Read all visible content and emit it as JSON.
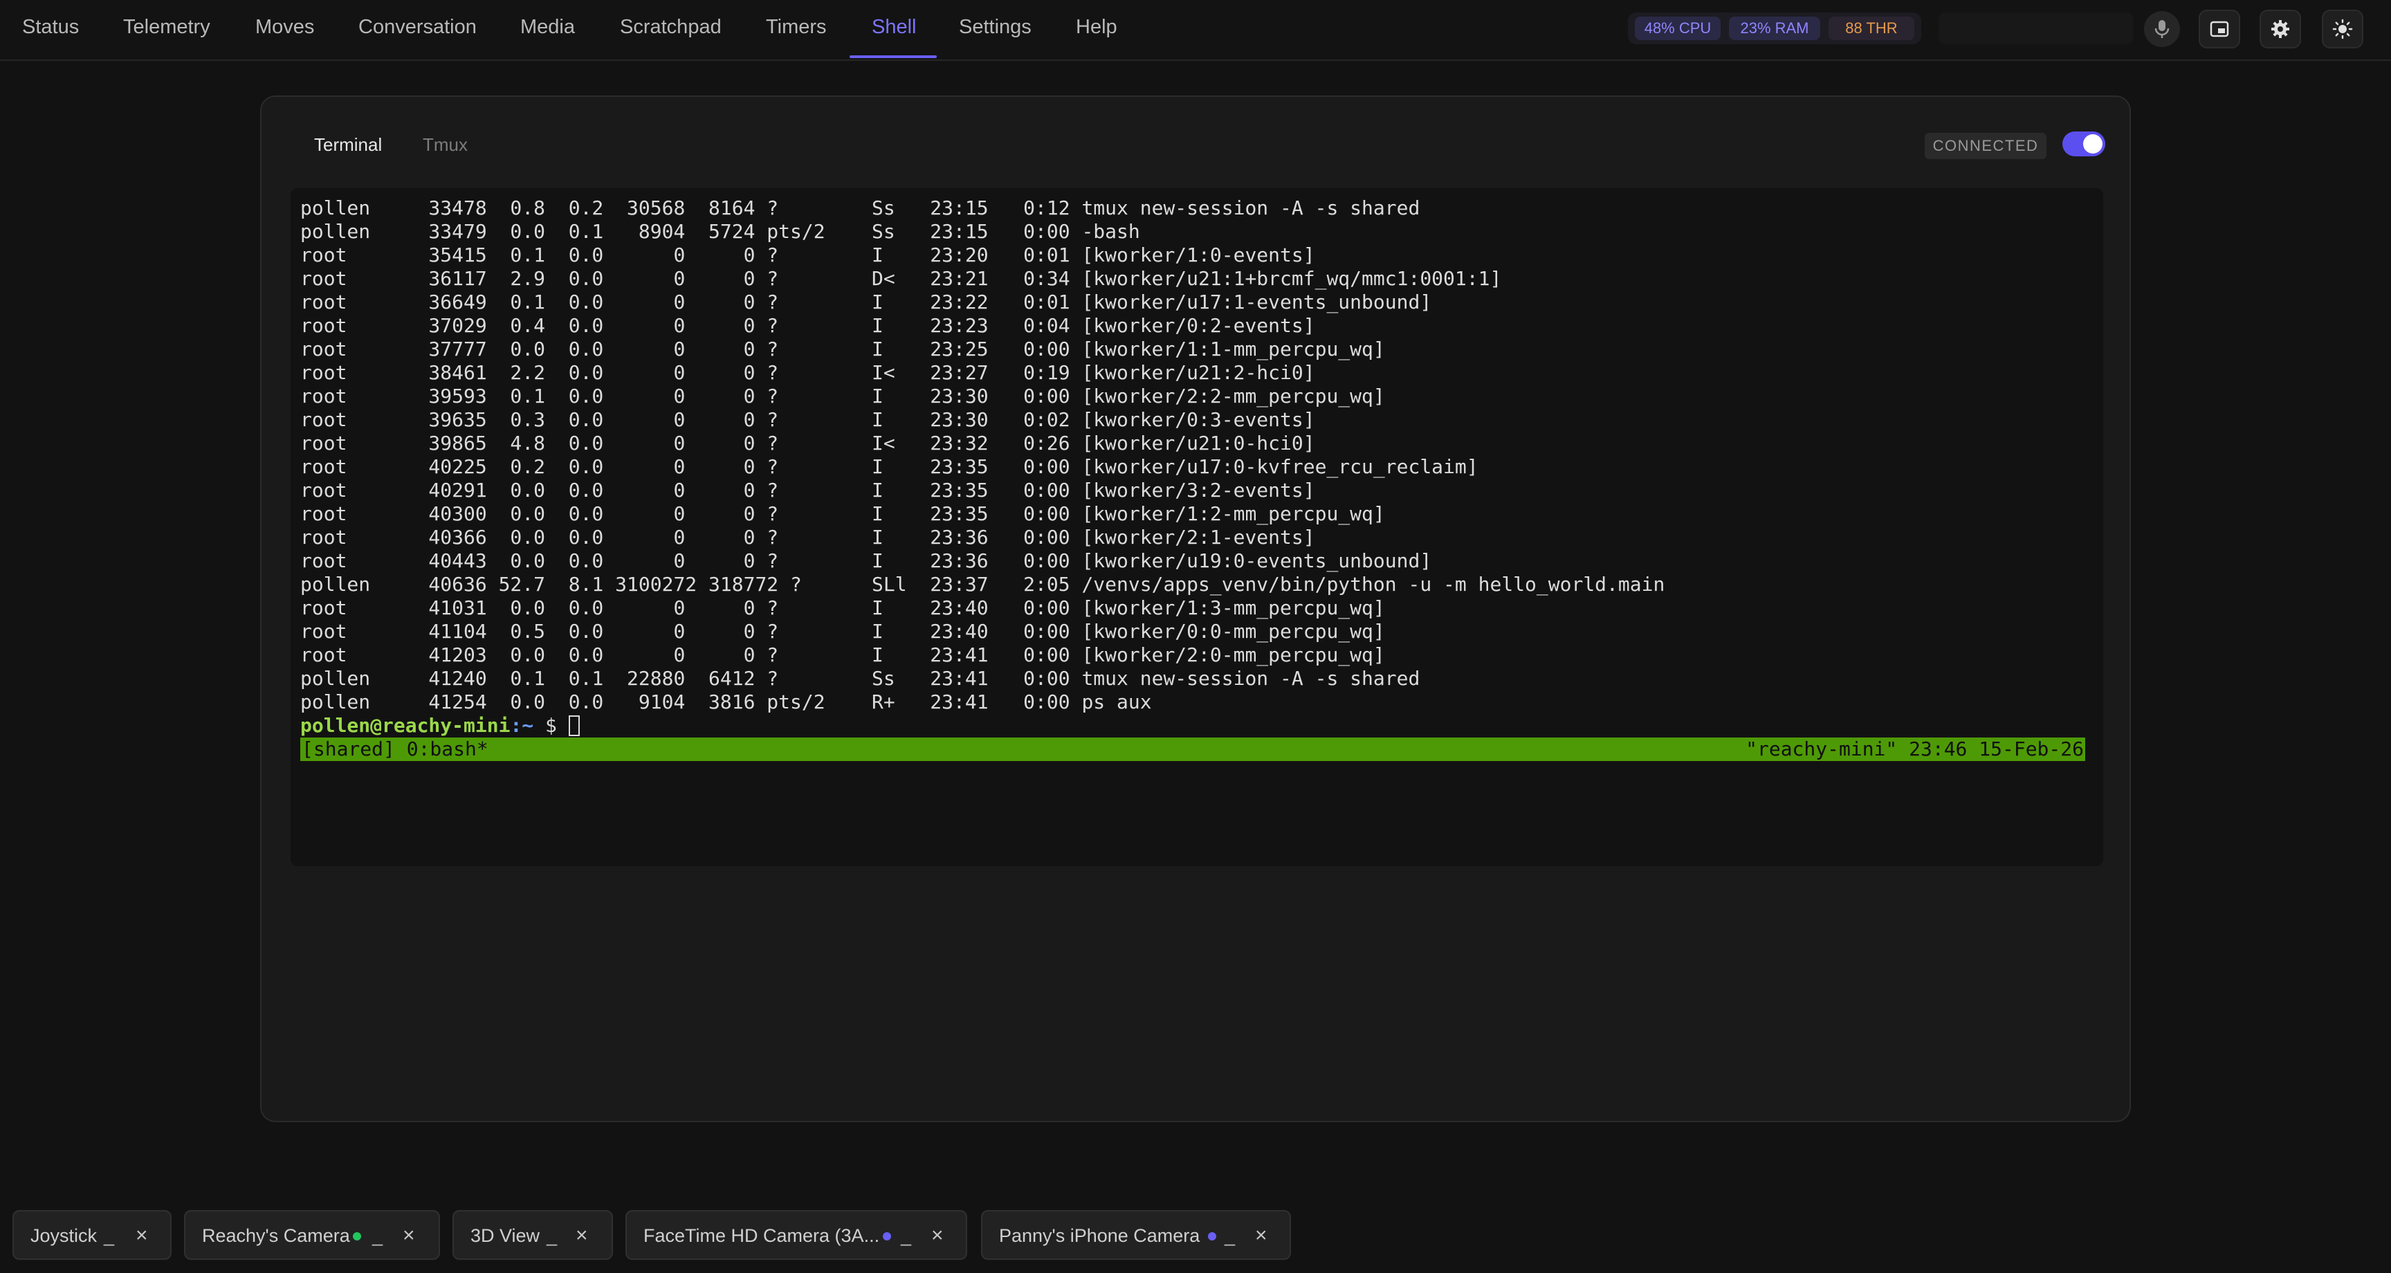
{
  "nav": {
    "tabs": [
      "Status",
      "Telemetry",
      "Moves",
      "Conversation",
      "Media",
      "Scratchpad",
      "Timers",
      "Shell",
      "Settings",
      "Help"
    ],
    "active": "Shell"
  },
  "stats": {
    "cpu": "48% CPU",
    "ram": "23% RAM",
    "thr": "88 THR"
  },
  "search": {
    "placeholder": ""
  },
  "icons": {
    "mic": "microphone-icon",
    "pip": "picture-in-picture-icon",
    "settings": "gear-icon",
    "theme": "sun-icon"
  },
  "colors": {
    "accent": "#6a5ff6",
    "prompt_user": "#9bd84a",
    "prompt_path": "#6b9cff",
    "tmux_bar": "#4e9a06"
  },
  "panel": {
    "tabs": [
      "Terminal",
      "Tmux"
    ],
    "active_tab": "Terminal",
    "status": "CONNECTED",
    "toggle_on": true
  },
  "terminal": {
    "lines": [
      "pollen     33478  0.8  0.2  30568  8164 ?        Ss   23:15   0:12 tmux new-session -A -s shared",
      "pollen     33479  0.0  0.1   8904  5724 pts/2    Ss   23:15   0:00 -bash",
      "root       35415  0.1  0.0      0     0 ?        I    23:20   0:01 [kworker/1:0-events]",
      "root       36117  2.9  0.0      0     0 ?        D<   23:21   0:34 [kworker/u21:1+brcmf_wq/mmc1:0001:1]",
      "root       36649  0.1  0.0      0     0 ?        I    23:22   0:01 [kworker/u17:1-events_unbound]",
      "root       37029  0.4  0.0      0     0 ?        I    23:23   0:04 [kworker/0:2-events]",
      "root       37777  0.0  0.0      0     0 ?        I    23:25   0:00 [kworker/1:1-mm_percpu_wq]",
      "root       38461  2.2  0.0      0     0 ?        I<   23:27   0:19 [kworker/u21:2-hci0]",
      "root       39593  0.1  0.0      0     0 ?        I    23:30   0:00 [kworker/2:2-mm_percpu_wq]",
      "root       39635  0.3  0.0      0     0 ?        I    23:30   0:02 [kworker/0:3-events]",
      "root       39865  4.8  0.0      0     0 ?        I<   23:32   0:26 [kworker/u21:0-hci0]",
      "root       40225  0.2  0.0      0     0 ?        I    23:35   0:00 [kworker/u17:0-kvfree_rcu_reclaim]",
      "root       40291  0.0  0.0      0     0 ?        I    23:35   0:00 [kworker/3:2-events]",
      "root       40300  0.0  0.0      0     0 ?        I    23:35   0:00 [kworker/1:2-mm_percpu_wq]",
      "root       40366  0.0  0.0      0     0 ?        I    23:36   0:00 [kworker/2:1-events]",
      "root       40443  0.0  0.0      0     0 ?        I    23:36   0:00 [kworker/u19:0-events_unbound]",
      "pollen     40636 52.7  8.1 3100272 318772 ?      SLl  23:37   2:05 /venvs/apps_venv/bin/python -u -m hello_world.main",
      "root       41031  0.0  0.0      0     0 ?        I    23:40   0:00 [kworker/1:3-mm_percpu_wq]",
      "root       41104  0.5  0.0      0     0 ?        I    23:40   0:00 [kworker/0:0-mm_percpu_wq]",
      "root       41203  0.0  0.0      0     0 ?        I    23:41   0:00 [kworker/2:0-mm_percpu_wq]",
      "pollen     41240  0.1  0.1  22880  6412 ?        Ss   23:41   0:00 tmux new-session -A -s shared",
      "pollen     41254  0.0  0.0   9104  3816 pts/2    R+   23:41   0:00 ps aux"
    ],
    "prompt_user": "pollen@reachy-mini",
    "prompt_path": ":~",
    "prompt_sign": " $ ",
    "tmux_left": "[shared] 0:bash*",
    "tmux_right": "\"reachy-mini\" 23:46 15-Feb-26"
  },
  "dock": [
    {
      "label": "Joystick",
      "dot": "",
      "min": "_",
      "close": "×"
    },
    {
      "label": "Reachy's Camera",
      "dot": "#22c55e",
      "min": "_",
      "close": "×"
    },
    {
      "label": "3D View",
      "dot": "",
      "min": "_",
      "close": "×"
    },
    {
      "label": "FaceTime HD Camera (3A...",
      "dot": "#6a5ff6",
      "min": "_",
      "close": "×"
    },
    {
      "label": "Panny's iPhone Camera",
      "dot": "#6a5ff6",
      "min": "_",
      "close": "×"
    }
  ]
}
